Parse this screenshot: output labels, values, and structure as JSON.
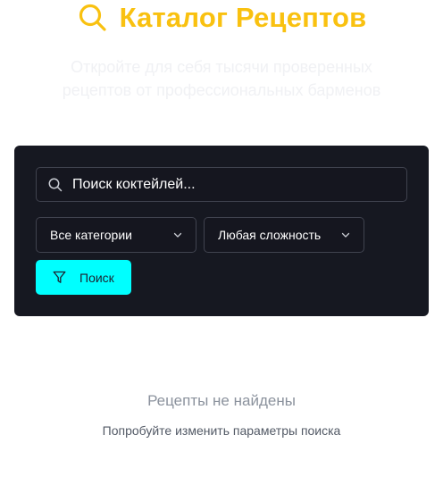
{
  "header": {
    "title": "Каталог Рецептов",
    "subtitle": "Откройте для себя тысячи проверенных рецептов от профессиональных барменов",
    "icon": "search-icon",
    "accent_color": "#f9c110"
  },
  "search": {
    "placeholder": "Поиск коктейлей..."
  },
  "filters": {
    "category_selected": "Все категории",
    "difficulty_selected": "Любая сложность"
  },
  "search_button": {
    "label": "Поиск",
    "color": "#00ffff"
  },
  "empty_state": {
    "title": "Рецепты не найдены",
    "message": "Попробуйте изменить параметры поиска"
  }
}
